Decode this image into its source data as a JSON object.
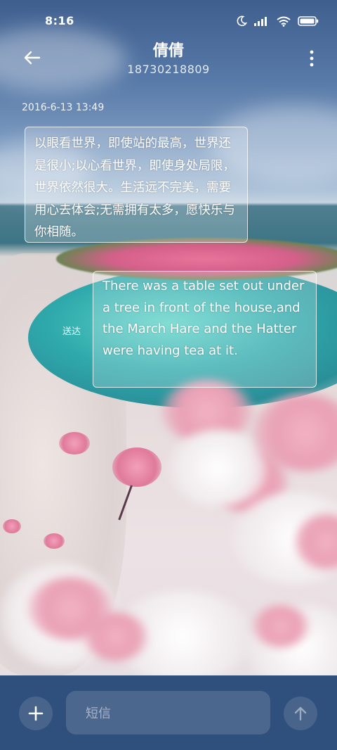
{
  "status_bar": {
    "time": "8:16",
    "icons": [
      "moon-icon",
      "signal-icon",
      "wifi-icon",
      "battery-icon"
    ]
  },
  "header": {
    "contact_name": "倩倩",
    "contact_number": "18730218809",
    "back_icon": "arrow-left-icon",
    "more_icon": "more-vertical-icon"
  },
  "conversation": {
    "timestamp": "2016-6-13 13:49",
    "messages": [
      {
        "direction": "incoming",
        "text": "以眼看世界，即使站的最高，世界还是很小;以心看世界，即使身处局限，世界依然很大。生活远不完美，需要用心去体会;无需拥有太多，愿快乐与你相随。"
      },
      {
        "direction": "outgoing",
        "text": "There was a table set out under a tree in front of the house,and the March Hare and the Hatter were having tea at it.",
        "status": "送达"
      }
    ]
  },
  "input_bar": {
    "placeholder": "短信",
    "add_icon": "plus-icon",
    "send_icon": "arrow-up-icon"
  },
  "colors": {
    "input_bar_bg": "#2f4f7c",
    "bubble_border": "#ffffff"
  }
}
